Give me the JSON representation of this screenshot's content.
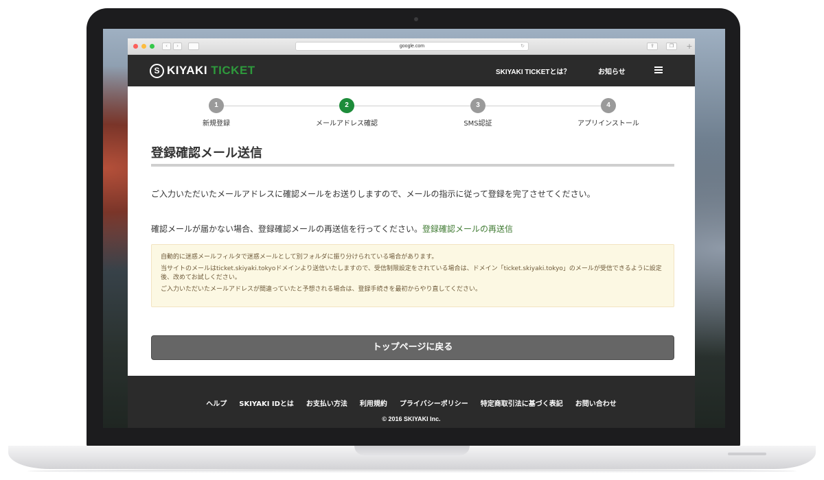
{
  "browser": {
    "url": "google.com",
    "reload_icon": "↻",
    "back_icon": "‹",
    "forward_icon": "›",
    "share_icon": "⇪",
    "tabs_icon": "❐",
    "new_tab_icon": "+"
  },
  "header": {
    "logo_mark": "S",
    "logo_part1": "KIYAKI ",
    "logo_part2": "TICKET",
    "nav_about": "SKIYAKI TICKETとは？",
    "nav_news": "お知らせ"
  },
  "steps": [
    {
      "number": "1",
      "label": "新規登録",
      "state": "done"
    },
    {
      "number": "2",
      "label": "メールアドレス確認",
      "state": "active"
    },
    {
      "number": "3",
      "label": "SMS認証",
      "state": "pending"
    },
    {
      "number": "4",
      "label": "アプリインストール",
      "state": "pending"
    }
  ],
  "main": {
    "title": "登録確認メール送信",
    "instruction": "ご入力いただいたメールアドレスに確認メールをお送りしますので、メールの指示に従って登録を完了させてください。",
    "resend_text": "確認メールが届かない場合、登録確認メールの再送信を行ってください。",
    "resend_link": "登録確認メールの再送信",
    "notice": [
      "自動的に迷惑メールフィルタで迷惑メールとして別フォルダに振り分けられている場合があります。",
      "当サイトのメールはticket.skiyaki.tokyoドメインより送信いたしますので、受信制限設定をされている場合は、ドメイン「ticket.skiyaki.tokyo」のメールが受信できるように設定後、改めてお試しください。",
      "ご入力いただいたメールアドレスが間違っていたと予想される場合は、登録手続きを最初からやり直してください。"
    ],
    "back_button": "トップページに戻る"
  },
  "footer": {
    "links": [
      "ヘルプ",
      "SKIYAKI IDとは",
      "お支払い方法",
      "利用規約",
      "プライバシーポリシー",
      "特定商取引法に基づく表記",
      "お問い合わせ"
    ],
    "copyright": "© 2016 SKIYAKI Inc."
  },
  "colors": {
    "accent_green": "#1d8c3a",
    "header_bg": "#2b2b2b",
    "link_green": "#3f7a32",
    "notice_bg": "#fcf8e3"
  }
}
